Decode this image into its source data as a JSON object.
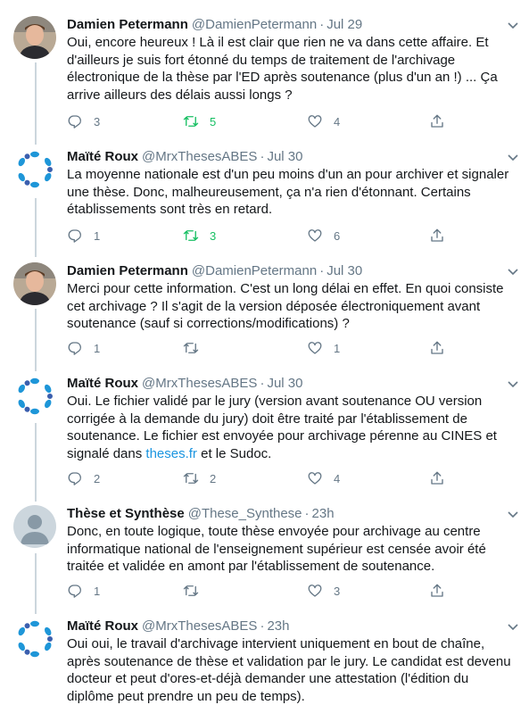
{
  "tweets": [
    {
      "name": "Damien Petermann",
      "handle": "@DamienPetermann",
      "sep": "·",
      "time": "Jul 29",
      "avatar": "person-photo-avatar",
      "text": "Oui, encore heureux ! Là il est clair que rien ne va dans cette affaire. Et d'ailleurs je suis fort étonné du temps de traitement de l'archivage électronique de la thèse par l'ED après soutenance (plus d'un an !) ... Ça arrive ailleurs des délais aussi longs ?",
      "replies": "3",
      "retweets": "5",
      "likes": "4",
      "retweeted": true
    },
    {
      "name": "Maïté Roux",
      "handle": "@MrxThesesABES",
      "sep": "·",
      "time": "Jul 30",
      "avatar": "abes-logo-avatar",
      "text": "La moyenne nationale est d'un peu moins d'un an pour archiver et signaler une thèse. Donc, malheureusement, ça n'a rien d'étonnant. Certains établissements sont très en retard.",
      "replies": "1",
      "retweets": "3",
      "likes": "6",
      "retweeted": true
    },
    {
      "name": "Damien Petermann",
      "handle": "@DamienPetermann",
      "sep": "·",
      "time": "Jul 30",
      "avatar": "person-photo-avatar",
      "text": "Merci pour cette information. C'est un long délai en effet. En quoi consiste cet archivage ? Il s'agit de la version déposée électroniquement avant soutenance (sauf si corrections/modifications) ?",
      "replies": "1",
      "retweets": "",
      "likes": "1",
      "retweeted": false
    },
    {
      "name": "Maïté Roux",
      "handle": "@MrxThesesABES",
      "sep": "·",
      "time": "Jul 30",
      "avatar": "abes-logo-avatar",
      "text_before": "Oui. Le fichier validé par le jury (version avant soutenance OU version corrigée à la demande du jury) doit être traité par l'établissement de soutenance. Le fichier est envoyée pour archivage pérenne au CINES et signalé dans ",
      "link": "theses.fr",
      "text_after": " et le Sudoc.",
      "replies": "2",
      "retweets": "2",
      "likes": "4",
      "retweeted": false
    },
    {
      "name": "Thèse et Synthèse",
      "handle": "@These_Synthese",
      "sep": "·",
      "time": "23h",
      "avatar": "default-avatar",
      "text": "Donc, en toute logique, toute thèse envoyée pour archivage au centre informatique national de l'enseignement supérieur est censée avoir été traitée et validée en amont par l'établissement de soutenance.",
      "replies": "1",
      "retweets": "",
      "likes": "3",
      "retweeted": false
    },
    {
      "name": "Maïté Roux",
      "handle": "@MrxThesesABES",
      "sep": "·",
      "time": "23h",
      "avatar": "abes-logo-avatar",
      "text": "Oui oui, le travail d'archivage intervient uniquement en bout de chaîne, après soutenance de thèse et validation par le jury. Le candidat est devenu docteur et peut d'ores-et-déjà demander une attestation (l'édition du diplôme peut prendre un peu de temps).",
      "replies": "",
      "retweets": "",
      "likes": "",
      "retweeted": false
    }
  ],
  "colors": {
    "text": "#14171a",
    "secondary": "#657786",
    "link": "#1b95e0",
    "retweet_active": "#17bf63",
    "thread_line": "#ccd6dd",
    "abes_blue": "#1da1f2"
  }
}
